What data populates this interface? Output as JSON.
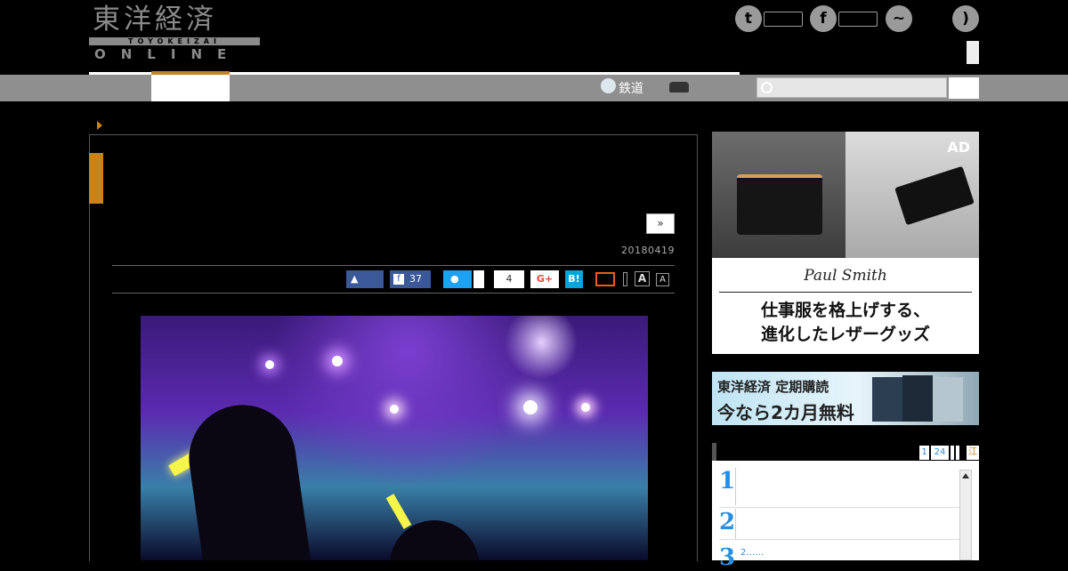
{
  "header": {
    "logo_main": "東洋経済",
    "logo_sub": "TOYOKEIZAI",
    "logo_online": "ONLINE"
  },
  "social": {
    "twitter_glyph": "t",
    "facebook_glyph": "f",
    "messenger_glyph": "~",
    "rss_glyph": ")"
  },
  "nav": {
    "tetsudo_label": "鉄道"
  },
  "search": {
    "placeholder": ""
  },
  "article": {
    "next_label": "»",
    "date": "20180419",
    "share": {
      "facebook_count": "37",
      "hatena_label": "B!",
      "gplus_label": "G+",
      "comment_count": "4",
      "font_large": "A",
      "font_small": "A"
    }
  },
  "ad": {
    "label": "AD",
    "brand": "Paul Smith",
    "copy_line1": "仕事服を格上げする、",
    "copy_line2": "進化したレザーグッズ"
  },
  "promo": {
    "title": "東洋経済 定期購読",
    "offer": "今なら2カ月無料"
  },
  "ranking": {
    "tabs": [
      "1",
      "24"
    ],
    "tab_extra": "江",
    "items": [
      {
        "rank": "1",
        "text": ""
      },
      {
        "rank": "2",
        "text": ""
      },
      {
        "rank": "3",
        "text": "2……"
      }
    ]
  },
  "colors": {
    "accent": "#c7841a",
    "nav_bg": "#8f8f8f",
    "facebook": "#3b5998",
    "twitter": "#1da1f2"
  }
}
